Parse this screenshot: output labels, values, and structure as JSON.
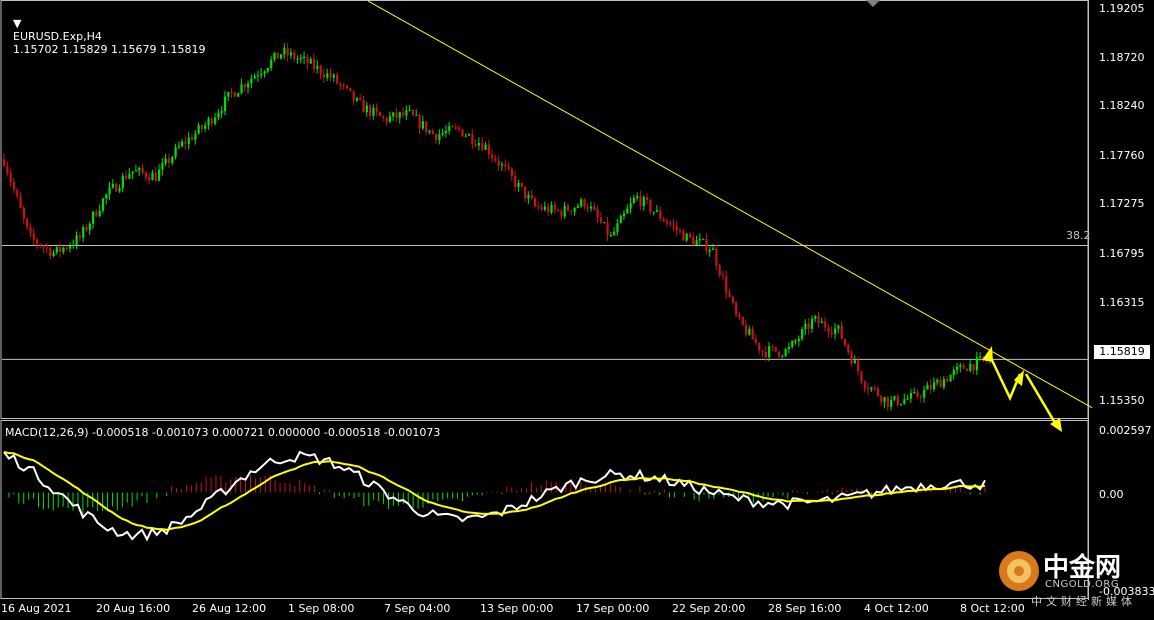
{
  "header": {
    "symbol": "EURUSD.Exp,H4",
    "ohlc": "1.15702 1.15829 1.15679 1.15819"
  },
  "macd_header": "MACD(12,26,9) -0.000518 -0.001073 0.000721 0.000000 -0.000518 -0.001073",
  "price_axis": [
    "1.19205",
    "1.18720",
    "1.18240",
    "1.17760",
    "1.17275",
    "1.16795",
    "1.16315",
    "1.15350"
  ],
  "current_price": "1.15819",
  "fib_label": "38.2",
  "macd_axis": [
    "0.002597",
    "0.00",
    "-0.003833"
  ],
  "time_axis": [
    "16 Aug 2021",
    "20 Aug 16:00",
    "26 Aug 12:00",
    "1 Sep 08:00",
    "7 Sep 04:00",
    "13 Sep 00:00",
    "17 Sep 00:00",
    "22 Sep 20:00",
    "28 Sep 16:00",
    "4 Oct 12:00",
    "8 Oct 12:00"
  ],
  "watermark": {
    "name": "中金网",
    "en": "CNGOLD.ORG",
    "cn": "中文财经新媒体"
  },
  "colors": {
    "bull": "#00e000",
    "bear": "#c81414",
    "trendline": "#ffff00",
    "signal": "#ffff00",
    "macd_line": "#ffffff",
    "hline": "#c0c0c0",
    "arrow": "#ffff00"
  },
  "chart_data": [
    {
      "type": "candlestick",
      "title": "EURUSD.Exp,H4",
      "ylim": [
        1.1525,
        1.193
      ],
      "x": [
        "16 Aug 2021",
        "20 Aug 16:00",
        "26 Aug 12:00",
        "1 Sep 08:00",
        "7 Sep 04:00",
        "13 Sep 00:00",
        "17 Sep 00:00",
        "22 Sep 20:00",
        "28 Sep 16:00",
        "4 Oct 12:00",
        "8 Oct 12:00"
      ],
      "close_path": [
        1.1776,
        1.17,
        1.1685,
        1.17,
        1.174,
        1.1765,
        1.176,
        1.179,
        1.181,
        1.184,
        1.186,
        1.188,
        1.187,
        1.1855,
        1.183,
        1.1815,
        1.182,
        1.18,
        1.1805,
        1.179,
        1.176,
        1.173,
        1.1725,
        1.1735,
        1.17,
        1.174,
        1.172,
        1.17,
        1.169,
        1.162,
        1.159,
        1.159,
        1.162,
        1.161,
        1.156,
        1.154,
        1.1545,
        1.156,
        1.1575,
        1.1582
      ],
      "horizontal_lines": [
        {
          "label": "38.2",
          "price": 1.16925
        },
        {
          "label": "1.15819",
          "price": 1.15819
        }
      ],
      "trendline": {
        "from": {
          "x": "7 Sep 04:00",
          "price": 1.193
        },
        "to": {
          "x": "8 Oct 12:00",
          "price": 1.1535
        }
      }
    },
    {
      "type": "macd",
      "title": "MACD(12,26,9)",
      "ylim": [
        -0.003833,
        0.002597
      ],
      "values": {
        "main": -0.000518,
        "signal": -0.001073,
        "histogram": 0.000721
      }
    }
  ]
}
